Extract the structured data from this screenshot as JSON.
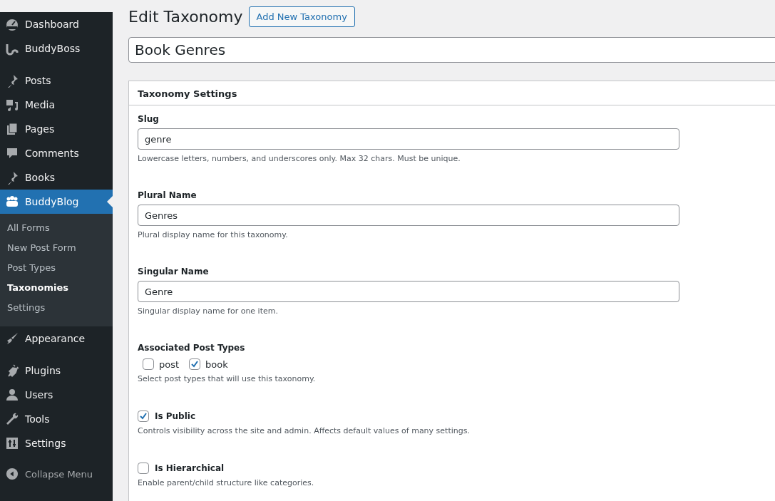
{
  "sidebar": {
    "menu_groups": [
      [
        {
          "label": "Dashboard",
          "selected": false
        },
        {
          "label": "BuddyBoss",
          "selected": false
        }
      ],
      [
        {
          "label": "Posts",
          "selected": false
        },
        {
          "label": "Media",
          "selected": false
        },
        {
          "label": "Pages",
          "selected": false
        },
        {
          "label": "Comments",
          "selected": false
        },
        {
          "label": "Books",
          "selected": false
        },
        {
          "label": "BuddyBlog",
          "selected": true,
          "submenu": [
            {
              "label": "All Forms",
              "selected": false
            },
            {
              "label": "New Post Form",
              "selected": false
            },
            {
              "label": "Post Types",
              "selected": false
            },
            {
              "label": "Taxonomies",
              "selected": true
            },
            {
              "label": "Settings",
              "selected": false
            }
          ]
        },
        {
          "label": "Appearance",
          "selected": false
        }
      ],
      [
        {
          "label": "Plugins",
          "selected": false
        },
        {
          "label": "Users",
          "selected": false
        },
        {
          "label": "Tools",
          "selected": false
        },
        {
          "label": "Settings",
          "selected": false
        }
      ]
    ],
    "collapse_label": "Collapse Menu"
  },
  "page_title": "Edit Taxonomy",
  "add_new_button": "Add New Taxonomy",
  "title_field": {
    "value": "Book Genres"
  },
  "settings_box": {
    "title": "Taxonomy Settings",
    "fields": [
      {
        "kind": "text",
        "label": "Slug",
        "value": "genre",
        "help": "Lowercase letters, numbers, and underscores only. Max 32 chars. Must be unique."
      },
      {
        "kind": "text",
        "label": "Plural Name",
        "value": "Genres",
        "help": "Plural display name for this taxonomy."
      },
      {
        "kind": "text",
        "label": "Singular Name",
        "value": "Genre",
        "help": "Singular display name for one item."
      },
      {
        "kind": "checkgroup",
        "label": "Associated Post Types",
        "options": [
          {
            "label": "post",
            "checked": false
          },
          {
            "label": "book",
            "checked": true
          }
        ],
        "help": "Select post types that will use this taxonomy."
      },
      {
        "kind": "checkbox",
        "label": "Is Public",
        "checked": true,
        "help": "Controls visibility across the site and admin. Affects default values of many settings."
      },
      {
        "kind": "checkbox",
        "label": "Is Hierarchical",
        "checked": false,
        "help": "Enable parent/child structure like categories."
      }
    ]
  }
}
